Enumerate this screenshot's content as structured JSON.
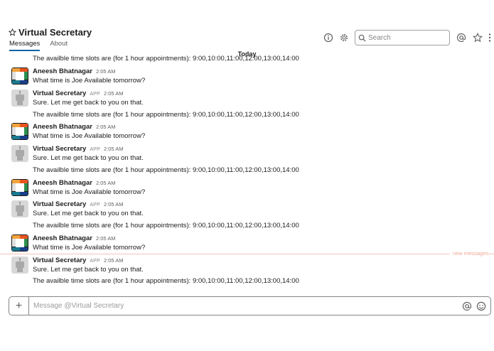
{
  "header": {
    "title": "Virtual Secretary",
    "tabs": [
      {
        "label": "Messages",
        "active": true
      },
      {
        "label": "About",
        "active": false
      }
    ],
    "icons": [
      "info-icon",
      "gear-icon",
      "search-icon",
      "at-icon",
      "star-icon",
      "more-icon"
    ],
    "search_placeholder": "Search"
  },
  "day_separator": "Today",
  "new_messages_label": "new messages",
  "messages": [
    {
      "type": "text-only",
      "text": "The availble time slots are (for 1 hour appointments): 9:00,10:00,11:00,12:00,13:00,14:00"
    },
    {
      "sender": "Aneesh Bhatnagar",
      "badge": "",
      "time": "2:05 AM",
      "text": "What time is Joe Available tomorrow?",
      "avatar": "user"
    },
    {
      "sender": "Virtual Secretary",
      "badge": "APP",
      "time": "2:05 AM",
      "text": "Sure. Let me get back to you on that.",
      "avatar": "bot"
    },
    {
      "type": "text-only",
      "text": "The availble time slots are (for 1 hour appointments): 9:00,10:00,11:00,12:00,13:00,14:00"
    },
    {
      "sender": "Aneesh Bhatnagar",
      "badge": "",
      "time": "2:05 AM",
      "text": "What time is Joe Available tomorrow?",
      "avatar": "user"
    },
    {
      "sender": "Virtual Secretary",
      "badge": "APP",
      "time": "2:05 AM",
      "text": "Sure. Let me get back to you on that.",
      "avatar": "bot"
    },
    {
      "type": "text-only",
      "text": "The availble time slots are (for 1 hour appointments): 9:00,10:00,11:00,12:00,13:00,14:00"
    },
    {
      "sender": "Aneesh Bhatnagar",
      "badge": "",
      "time": "2:05 AM",
      "text": "What time is Joe Available tomorrow?",
      "avatar": "user"
    },
    {
      "sender": "Virtual Secretary",
      "badge": "APP",
      "time": "2:05 AM",
      "text": "Sure. Let me get back to you on that.",
      "avatar": "bot"
    },
    {
      "type": "text-only",
      "text": "The availble time slots are (for 1 hour appointments): 9:00,10:00,11:00,12:00,13:00,14:00"
    },
    {
      "sender": "Aneesh Bhatnagar",
      "badge": "",
      "time": "2:05 AM",
      "text": "What time is Joe Available tomorrow?",
      "avatar": "user"
    },
    {
      "sender": "Virtual Secretary",
      "badge": "APP",
      "time": "2:05 AM",
      "text": "Sure. Let me get back to you on that.",
      "avatar": "bot"
    },
    {
      "type": "text-only",
      "text": "The availble time slots are (for 1 hour appointments): 9:00,10:00,11:00,12:00,13:00,14:00"
    }
  ],
  "composer": {
    "placeholder": "Message @Virtual Secretary",
    "plus_label": "+"
  }
}
